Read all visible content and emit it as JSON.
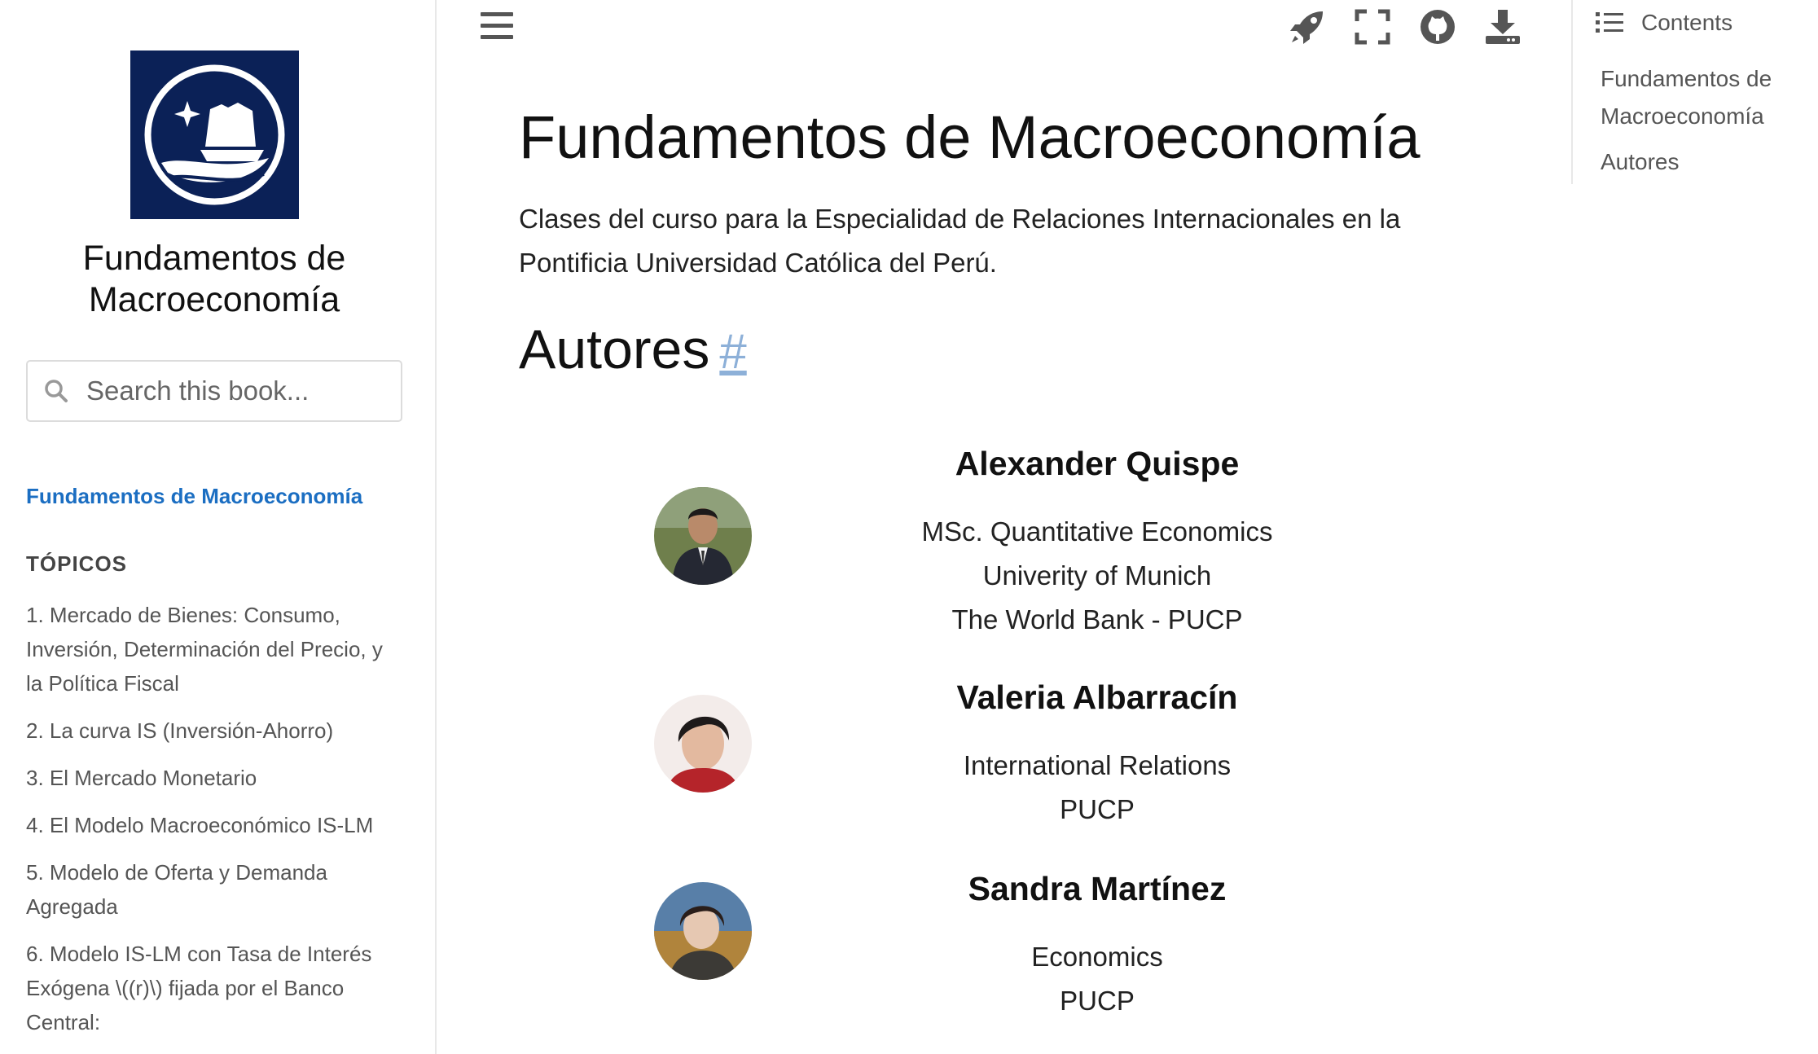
{
  "sidebar": {
    "book_title": "Fundamentos de Macroeconomía",
    "search_placeholder": "Search this book...",
    "home_link": "Fundamentos de Macroeconomía",
    "caption": "TÓPICOS",
    "items": [
      "1. Mercado de Bienes: Consumo, Inversión, Determinación del Precio, y la Política Fiscal",
      "2. La curva IS (Inversión-Ahorro)",
      "3. El Mercado Monetario",
      "4. El Modelo Macroeconómico IS-LM",
      "5. Modelo de Oferta y Demanda Agregada",
      "6. Modelo IS-LM con Tasa de Interés Exógena \\((r)\\) fijada por el Banco Central:"
    ],
    "logo_color": "#0b2157",
    "link_color": "#1b6ec2"
  },
  "toolbar": {
    "icons": [
      "menu-icon",
      "rocket-icon",
      "fullscreen-icon",
      "github-icon",
      "download-icon"
    ]
  },
  "main": {
    "title": "Fundamentos de Macroeconomía",
    "intro": "Clases del curso para la Especialidad de Relaciones Internacionales en la Pontificia Universidad Católica del Perú.",
    "authors_heading": "Autores",
    "anchor": "#",
    "authors": [
      {
        "name": "Alexander Quispe",
        "lines": [
          "MSc. Quantitative Economics",
          "Univerity of Munich",
          "The World Bank - PUCP"
        ]
      },
      {
        "name": "Valeria Albarracín",
        "lines": [
          "International Relations",
          "PUCP"
        ]
      },
      {
        "name": "Sandra Martínez",
        "lines": [
          "Economics",
          "PUCP"
        ]
      }
    ]
  },
  "toc": {
    "header": "Contents",
    "items": [
      "Fundamentos de Macroeconomía",
      "Autores"
    ]
  }
}
